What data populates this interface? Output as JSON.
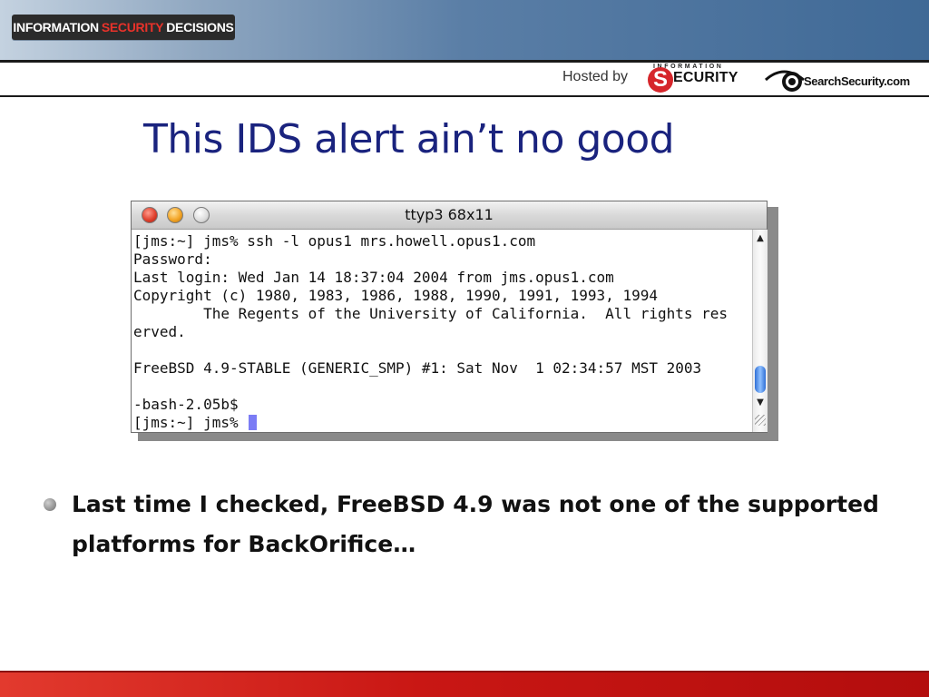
{
  "header": {
    "brand": {
      "word1": "INFORMATION",
      "word2": "SECURITY",
      "word3": "DECISIONS"
    },
    "hosted_by": "Hosted by",
    "security_logo": {
      "top": "INFORMATION",
      "letter": "S",
      "rest": "ECURITY"
    },
    "searchsecurity_logo": "SearchSecurity.com"
  },
  "slide": {
    "title": "This IDS alert ain’t no good",
    "bullet": "Last time I checked, FreeBSD 4.9 was not one of the supported platforms for BackOrifice…"
  },
  "terminal": {
    "title": "ttyp3 68x11",
    "lines": [
      "[jms:~] jms% ssh -l opus1 mrs.howell.opus1.com",
      "Password:",
      "Last login: Wed Jan 14 18:37:04 2004 from jms.opus1.com",
      "Copyright (c) 1980, 1983, 1986, 1988, 1990, 1991, 1993, 1994",
      "        The Regents of the University of California.  All rights res",
      "erved.",
      "",
      "FreeBSD 4.9-STABLE (GENERIC_SMP) #1: Sat Nov  1 02:34:57 MST 2003",
      "",
      "-bash-2.05b$",
      "[jms:~] jms% "
    ]
  },
  "colors": {
    "title": "#1a237e",
    "accent_red": "#c91714",
    "cursor": "#7b7cf5"
  },
  "icons": {
    "close": "close-icon",
    "minimize": "minimize-icon",
    "zoom": "zoom-icon",
    "scroll_up": "scroll-up-arrow-icon",
    "scroll_down": "scroll-down-arrow-icon"
  }
}
